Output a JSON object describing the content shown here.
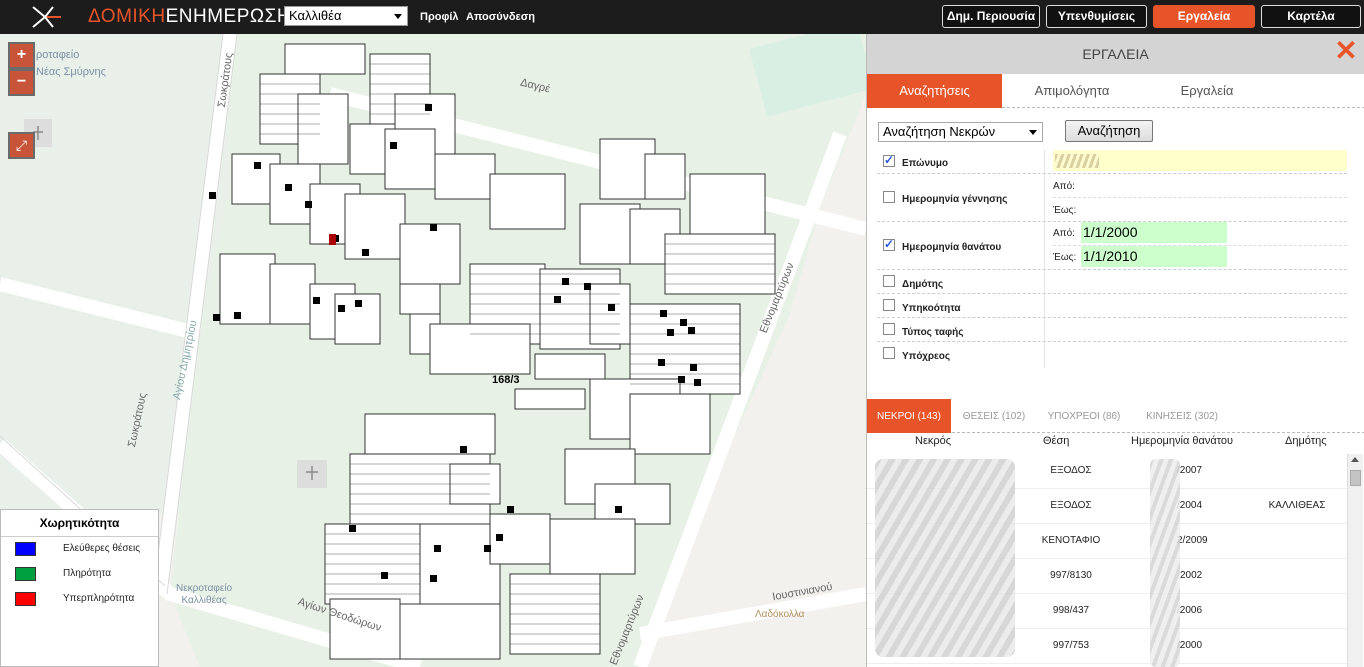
{
  "header": {
    "brand_part1": "ΔΟΜΙΚΗ",
    "brand_part2": "ΕΝΗΜΕΡΩΣΗ",
    "municipality": "Καλλιθέα",
    "links": [
      "Προφίλ",
      "Αποσύνδεση"
    ],
    "buttons": [
      {
        "label": "Δημ. Περιουσία",
        "active": false
      },
      {
        "label": "Υπενθυμίσεις",
        "active": false
      },
      {
        "label": "Εργαλεία",
        "active": true
      },
      {
        "label": "Καρτέλα",
        "active": false
      }
    ]
  },
  "map": {
    "zoom_in": "+",
    "zoom_out": "−",
    "expand_icon": "expand-icon",
    "labels": {
      "poi_top": "Κοιμητήριο Νέας Σμύρνης",
      "poi_top_visible": "ροταφείο\nΝέας Σμύρνης",
      "poi_bottom": "Νεκροταφείο\nΚαλλιθέας",
      "poi_bottom_right": "Λαδόκολλα",
      "plot": "168/3"
    },
    "streets": [
      "Δαγρέ",
      "Σωκράτους",
      "Εθνομαρτύρων",
      "Αγίων Θεοδώρων",
      "Ιουστινιανού",
      "Σωκράτους",
      "Αγίου Δημητρίου",
      "Εθνομαρτύρων"
    ],
    "legend": {
      "title": "Χωρητικότητα",
      "items": [
        {
          "label": "Ελεύθερες θέσεις",
          "color": "#0000ff"
        },
        {
          "label": "Πληρότητα",
          "color": "#00a040"
        },
        {
          "label": "Υπερπληρότητα",
          "color": "#ff0000"
        }
      ]
    }
  },
  "panel": {
    "title": "ΕΡΓΑΛΕΙΑ",
    "tabs": [
      {
        "label": "Αναζητήσεις",
        "active": true
      },
      {
        "label": "Απιμολόγητα",
        "active": false
      },
      {
        "label": "Εργαλεία",
        "active": false
      }
    ],
    "search_type": "Αναζήτηση Νεκρών",
    "search_button": "Αναζήτηση",
    "fields": [
      {
        "label": "Επώνυμο",
        "checked": true
      },
      {
        "label": "Ημερομηνία γέννησης",
        "checked": false,
        "from_label": "Από:",
        "to_label": "Έως:"
      },
      {
        "label": "Ημερομηνία θανάτου",
        "checked": true,
        "from_label": "Από:",
        "to_label": "Έως:",
        "from_value": "1/1/2000",
        "to_value": "1/1/2010"
      },
      {
        "label": "Δημότης",
        "checked": false
      },
      {
        "label": "Υπηκοότητα",
        "checked": false
      },
      {
        "label": "Τύπος ταφής",
        "checked": false
      },
      {
        "label": "Υπόχρεος",
        "checked": false
      }
    ],
    "result_tabs": [
      {
        "label": "ΝΕΚΡΟΙ (143)",
        "active": true
      },
      {
        "label": "ΘΕΣΕΙΣ (102)",
        "active": false
      },
      {
        "label": "ΥΠΟΧΡΕΟΙ (86)",
        "active": false
      },
      {
        "label": "ΚΙΝΗΣΕΙΣ (302)",
        "active": false
      }
    ],
    "columns": [
      "Νεκρός",
      "Θέση",
      "Ημερομηνία θανάτου",
      "Δημότης"
    ],
    "rows": [
      {
        "position": "ΕΞΟΔΟΣ",
        "date": "/2007",
        "citizen": ""
      },
      {
        "position": "ΕΞΟΔΟΣ",
        "date": "/2004",
        "citizen": "ΚΑΛΛΙΘΕΑΣ"
      },
      {
        "position": "ΚΕΝΟΤΑΦΙΟ",
        "date": "2/2009",
        "citizen": ""
      },
      {
        "position": "997/8130",
        "date": "2002",
        "citizen": ""
      },
      {
        "position": "998/437",
        "date": "/2006",
        "citizen": ""
      },
      {
        "position": "997/753",
        "date": "/2000",
        "citizen": ""
      }
    ]
  }
}
